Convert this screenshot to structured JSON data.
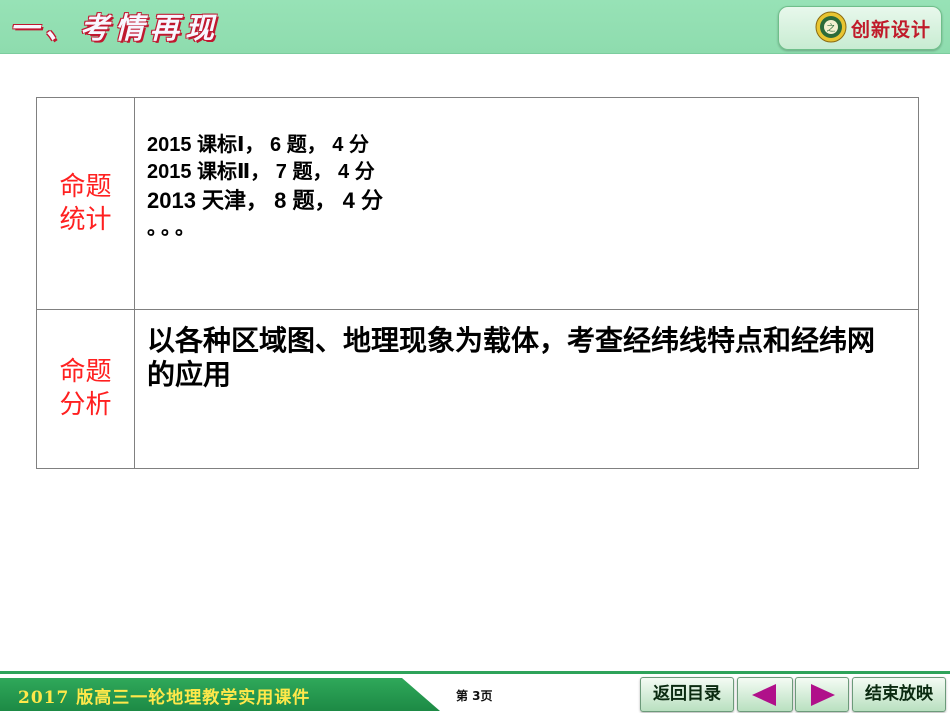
{
  "header": {
    "title": "一、考情再现",
    "logo_text": "创新设计"
  },
  "table": {
    "rows": [
      {
        "label_lines": [
          "命题",
          "统计"
        ],
        "lines": [
          "2015 课标Ⅰ， 6 题， 4 分",
          "2015 课标Ⅱ， 7 题， 4 分",
          "2013 天津， 8 题， 4 分"
        ],
        "ellipsis": "。。。"
      },
      {
        "label_lines": [
          "命题",
          "分析"
        ],
        "text": "以各种区域图、地理现象为载体，考查经纬线特点和经纬网的应用"
      }
    ]
  },
  "footer": {
    "course": "2017 版高三一轮地理教学实用课件",
    "page": "第 3页",
    "toc_button": "返回目录",
    "end_button": "结束放映"
  },
  "icons": {
    "prev": "left-triangle-arrow-icon",
    "next": "right-triangle-arrow-icon",
    "logo": "logo-seal-icon"
  },
  "colors": {
    "header_bg": "#8edcae",
    "label_red": "#ff2020",
    "footer_green": "#1d8a45",
    "footer_text": "#ffe84a",
    "arrow": "#b0108a"
  }
}
